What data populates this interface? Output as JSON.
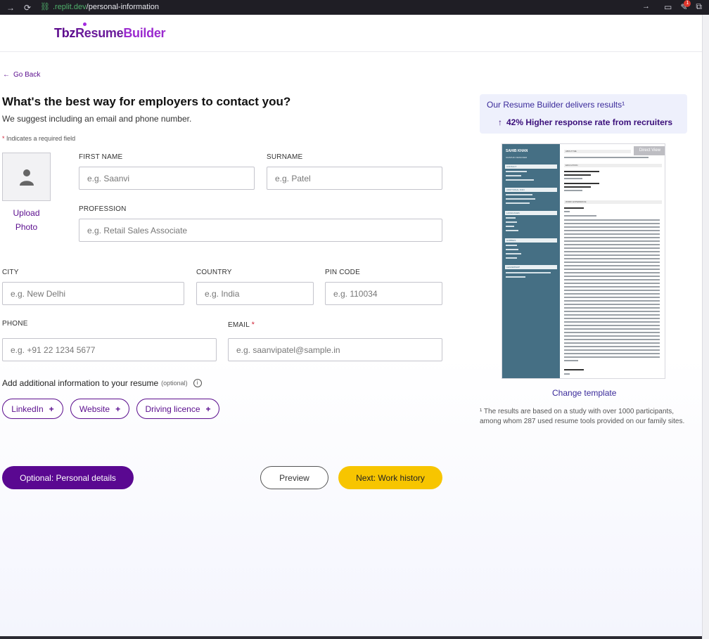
{
  "browser": {
    "url_host": ".replit.dev",
    "url_path": "/personal-information"
  },
  "logo": {
    "part1": "Tbz",
    "part2": "Resume",
    "part3": "Builder"
  },
  "nav": {
    "go_back": "Go Back"
  },
  "form": {
    "title": "What's the best way for employers to contact you?",
    "subtitle": "We suggest including an email and phone number.",
    "required_note": "Indicates a required field",
    "required_star": "*",
    "upload_photo": "Upload Photo",
    "fields": {
      "first_name": {
        "label": "FIRST NAME",
        "placeholder": "e.g. Saanvi"
      },
      "surname": {
        "label": "SURNAME",
        "placeholder": "e.g. Patel"
      },
      "profession": {
        "label": "PROFESSION",
        "placeholder": "e.g. Retail Sales Associate"
      },
      "city": {
        "label": "CITY",
        "placeholder": "e.g. New Delhi"
      },
      "country": {
        "label": "COUNTRY",
        "placeholder": "e.g. India"
      },
      "pin_code": {
        "label": "PIN CODE",
        "placeholder": "e.g. 110034"
      },
      "phone": {
        "label": "PHONE",
        "placeholder": "e.g. +91 22 1234 5677"
      },
      "email": {
        "label": "EMAIL",
        "placeholder": "e.g. saanvipatel@sample.in"
      }
    },
    "additional": {
      "text": "Add additional information to your resume",
      "optional": "(optional)",
      "chips": [
        "LinkedIn",
        "Website",
        "Driving licence"
      ]
    },
    "buttons": {
      "optional_details": "Optional: Personal details",
      "preview": "Preview",
      "next": "Next: Work history"
    }
  },
  "sidebar": {
    "promo_title": "Our Resume Builder delivers results¹",
    "promo_stat": "42% Higher response rate from recruiters",
    "preview": {
      "name": "SAHIB KHAN",
      "role": "GRAPHIC DESIGNER",
      "direct_view": "Direct View",
      "sections_left": [
        "CONTACT",
        "ADDITIONAL INFO",
        "LANGUAGES",
        "HOBBIES",
        "LEADERSHIP"
      ],
      "sections_right": [
        "ABOUT ME",
        "EDUCATION",
        "WORK EXPERIENCE"
      ]
    },
    "change_template": "Change template",
    "footnote": "¹ The results are based on a study with over 1000 participants, among whom 287 used resume tools provided on our family sites."
  },
  "colors": {
    "brand_purple": "#5a0891",
    "accent_yellow": "#f7c500",
    "template_blue": "#456f84"
  }
}
